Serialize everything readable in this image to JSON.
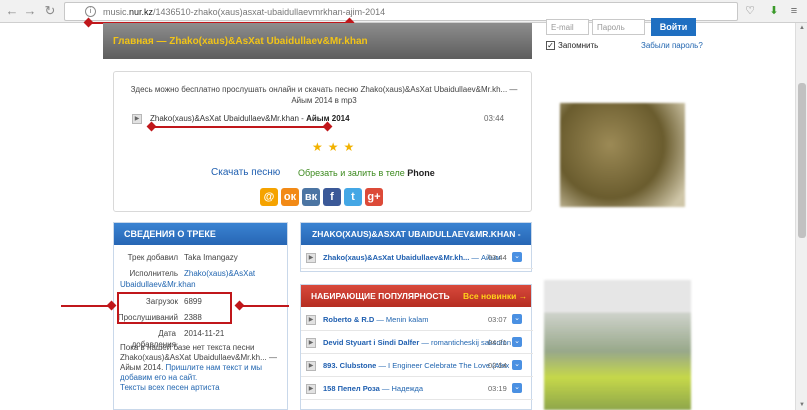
{
  "browser": {
    "url_prefix": "music.",
    "url_domain": "nur.kz",
    "url_path": "/1436510-zhako(xaus)asxat-ubaidullaevmrkhan-ajim-2014"
  },
  "breadcrumb": {
    "home": "Главная",
    "sep": " — ",
    "current": "Zhako(xaus)&AsXat Ubaidullaev&Mr.khan"
  },
  "login": {
    "email_placeholder": "E-mail",
    "password_placeholder": "Пароль",
    "submit": "Войти",
    "remember": "Запомнить",
    "forgot": "Забыли пароль?"
  },
  "player": {
    "description": "Здесь можно бесплатно прослушать онлайн и скачать песню Zhako(xaus)&AsXat Ubaidullaev&Mr.kh... — Айым 2014 в mp3",
    "track_artist": "Zhako(xaus)&AsXat Ubaidullaev&Mr.khan - ",
    "track_name": "Айым 2014",
    "track_time": "03:44",
    "stars": "★★★",
    "download": "Скачать песню",
    "phone_text": "Обрезать и залить в теле",
    "phone_brand": "Phone"
  },
  "share": [
    {
      "glyph": "@",
      "color": "#f5a300"
    },
    {
      "glyph": "ок",
      "color": "#f28a16"
    },
    {
      "glyph": "вк",
      "color": "#4c75a3"
    },
    {
      "glyph": "f",
      "color": "#3b5998"
    },
    {
      "glyph": "t",
      "color": "#44a7e5"
    },
    {
      "glyph": "g+",
      "color": "#dc4a38"
    }
  ],
  "track_info": {
    "title": "СВЕДЕНИЯ О ТРЕКЕ",
    "added_by_label": "Трек добавил",
    "added_by": "Taka Imangazy",
    "artist_label": "Исполнитель",
    "artist_1": "Zhako(xaus)&AsXat",
    "artist_2": "Ubaidullaev&Mr.khan",
    "downloads_label": "Загрузок",
    "downloads": "6899",
    "plays_label": "Прослушиваний",
    "plays": "2388",
    "date_label": "Дата добавления",
    "date": "2014-11-21",
    "note": "Пока в нашей базе нет текста песни Zhako(xaus)&AsXat Ubaidullaev&Mr.kh... — Айым 2014. ",
    "note_link": "Пришлите нам текст и мы добавим его на сайт.",
    "all_lyrics": "Тексты всех песен артиста"
  },
  "related": {
    "title": "ZHAKO(XAUS)&ASXAT UBAIDULLAEV&MR.KHAN -",
    "items": [
      {
        "artist": "Zhako(xaus)&AsXat Ubaidullaev&Mr.kh...",
        "sep": " — ",
        "song": "Айым",
        "time": "03:44"
      }
    ]
  },
  "popular": {
    "title": "НАБИРАЮЩИЕ ПОПУЛЯРНОСТЬ",
    "new_link": "Все новинки →",
    "items": [
      {
        "artist": "Roberto & R.D",
        "sep": " — ",
        "song": "Menin kalam",
        "time": "03:07"
      },
      {
        "artist": "Devid Styuart i Sindi Dalfer",
        "sep": " — ",
        "song": "romanticheskij saksofon",
        "time": "04:21"
      },
      {
        "artist": "893. Clubstone",
        "sep": " — ",
        "song": "I Engineer Celebrate The Love (Alex",
        "time": "02:54"
      },
      {
        "artist": "158 Пепел Роза",
        "sep": " — ",
        "song": "Надежда",
        "time": "03:19"
      }
    ]
  }
}
